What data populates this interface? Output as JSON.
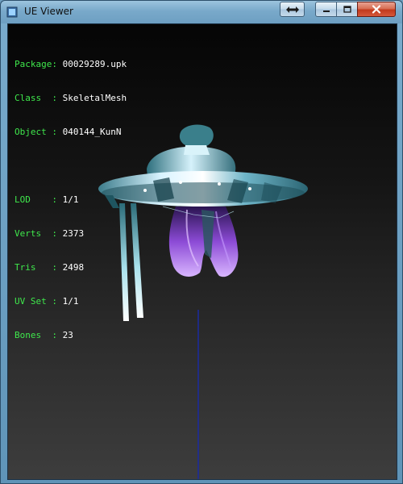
{
  "window": {
    "title": "UE Viewer"
  },
  "info": {
    "package_label": "Package: ",
    "package": "00029289.upk",
    "class_label": "Class  : ",
    "class": "SkeletalMesh",
    "object_label": "Object : ",
    "object": "040144_KunN",
    "lod_label": "LOD    : ",
    "lod": "1/1",
    "verts_label": "Verts  : ",
    "verts": "2373",
    "tris_label": "Tris   : ",
    "tris": "2498",
    "uvset_label": "UV Set : ",
    "uvset": "1/1",
    "bones_label": "Bones  : ",
    "bones": "23"
  },
  "icons": {
    "restore": "double-arrow-icon",
    "minimize": "minimize-icon",
    "maximize": "maximize-icon",
    "close": "close-icon"
  }
}
